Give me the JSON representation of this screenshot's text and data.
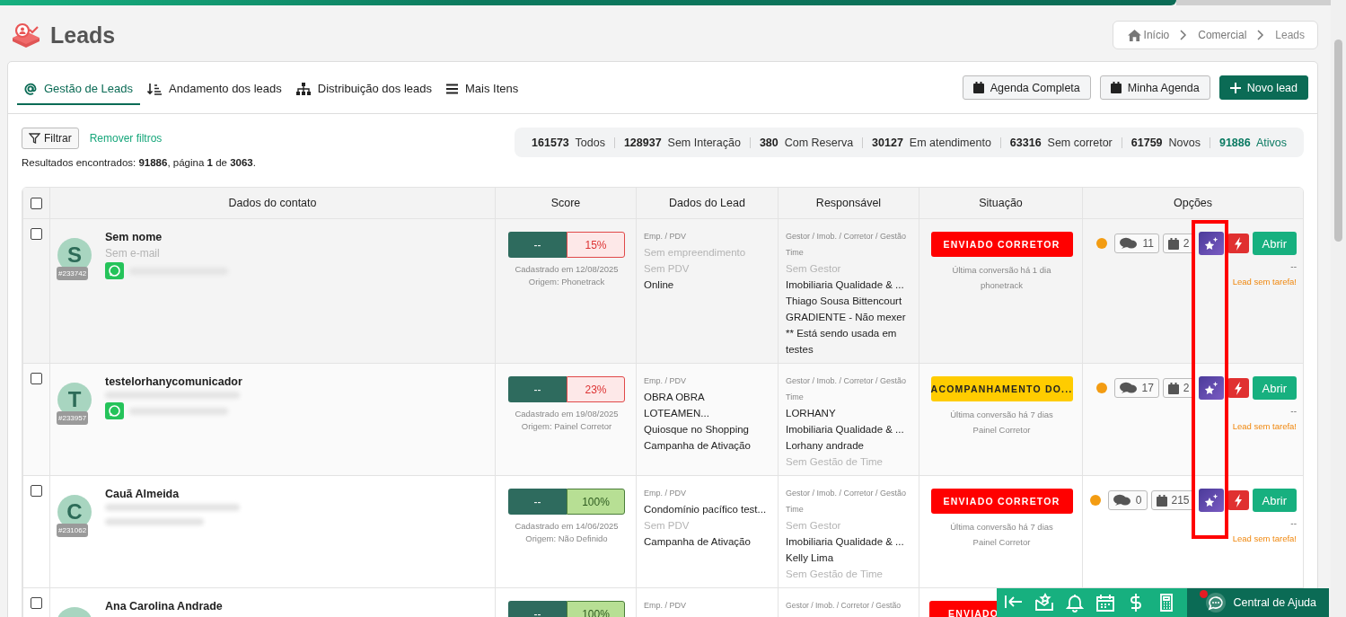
{
  "page": {
    "title": "Leads"
  },
  "breadcrumb": [
    {
      "label": "Início",
      "kind": "home"
    },
    {
      "label": "Comercial",
      "kind": "link"
    },
    {
      "label": "Leads",
      "kind": "current"
    }
  ],
  "tabs": [
    {
      "label": "Gestão de Leads",
      "selected": true
    },
    {
      "label": "Andamento dos leads",
      "selected": false
    },
    {
      "label": "Distribuição dos leads",
      "selected": false
    },
    {
      "label": "Mais Itens",
      "selected": false
    }
  ],
  "actions": [
    {
      "label": "Agenda Completa",
      "kind": "outline"
    },
    {
      "label": "Minha Agenda",
      "kind": "outline"
    },
    {
      "label": "Novo lead",
      "kind": "primary"
    }
  ],
  "filter": {
    "button": "Filtrar",
    "clear": "Remover filtros"
  },
  "results": "Resultados encontrados: **91886**, página **1** de **3063**.",
  "counters": [
    {
      "count": "161573",
      "label": "Todos",
      "selected": false
    },
    {
      "count": "128937",
      "label": "Sem Interação",
      "selected": false
    },
    {
      "count": "380",
      "label": "Com Reserva",
      "selected": false
    },
    {
      "count": "30127",
      "label": "Em atendimento",
      "selected": false
    },
    {
      "count": "63316",
      "label": "Sem corretor",
      "selected": false
    },
    {
      "count": "61759",
      "label": "Novos",
      "selected": false
    },
    {
      "count": "91886",
      "label": "Ativos",
      "selected": true
    }
  ],
  "table": {
    "all_checked": false,
    "columns": [
      "Dados do contato",
      "Score",
      "Dados do Lead",
      "Responsável",
      "Situação",
      "Opções"
    ],
    "rows": [
      {
        "checked": false,
        "initial": "S",
        "id": "#233742",
        "name": "Sem nome",
        "email": "Sem e-mail",
        "whatsapp": true,
        "score": "--",
        "percent": "15%",
        "high_score": false,
        "registered": "Cadastrado em 12/08/2025",
        "origin": "Origem: Phonetrack",
        "lead_label": "Emp. / PDV",
        "lead_lines": [
          {
            "text": "Sem empreendimento",
            "muted": true
          },
          {
            "text": "Sem PDV",
            "muted": true
          },
          {
            "text": "Online",
            "muted": false
          }
        ],
        "resp_label": "Gestor / Imob. / Corretor / Gestão Time",
        "resp_lines": [
          {
            "text": "Sem Gestor",
            "muted": true
          },
          {
            "text": "Imobiliaria Qualidade & ...",
            "muted": false
          },
          {
            "text": "Thiago Sousa Bittencourt GRADIENTE - Não mexer ** Está sendo usada em testes",
            "muted": false
          }
        ],
        "status": "ENVIADO CORRETOR",
        "color": "#ff0000",
        "last": "Última conversão há 1 dia",
        "source": "phonetrack",
        "messages": "11",
        "tasks": "2",
        "open": "Abrir",
        "extra": "--",
        "task_note": "Lead sem tarefa!"
      },
      {
        "checked": false,
        "initial": "T",
        "id": "#233957",
        "name": "testelorhanycomunicador",
        "whatsapp": true,
        "score": "--",
        "percent": "23%",
        "high_score": false,
        "registered": "Cadastrado em 19/08/2025",
        "origin": "Origem: Painel Corretor",
        "lead_label": "Emp. / PDV",
        "lead_lines": [
          {
            "text": "OBRA OBRA LOTEAMEN...",
            "muted": false
          },
          {
            "text": "Quiosque no Shopping",
            "muted": false
          },
          {
            "text": "Campanha de Ativação",
            "muted": false
          }
        ],
        "resp_label": "Gestor / Imob. / Corretor / Gestão Time",
        "resp_lines": [
          {
            "text": "LORHANY",
            "muted": false
          },
          {
            "text": "Imobiliaria Qualidade & ...",
            "muted": false
          },
          {
            "text": "Lorhany andrade",
            "muted": false
          },
          {
            "text": "Sem Gestão de Time",
            "muted": true
          }
        ],
        "status": "ACOMPANHAMENTO DO...",
        "color": "#ffcc00",
        "last": "Última conversão há 7 dias",
        "source": "Painel Corretor",
        "messages": "17",
        "tasks": "2",
        "open": "Abrir",
        "extra": "--",
        "task_note": "Lead sem tarefa!"
      },
      {
        "checked": false,
        "initial": "C",
        "id": "#231062",
        "name": "Cauã Almeida",
        "whatsapp": false,
        "score": "--",
        "percent": "100%",
        "high_score": true,
        "registered": "Cadastrado em 14/06/2025",
        "origin": "Origem: Não Definido",
        "lead_label": "Emp. / PDV",
        "lead_lines": [
          {
            "text": "Condomínio pacífico test...",
            "muted": false
          },
          {
            "text": "Sem PDV",
            "muted": true
          },
          {
            "text": "Campanha de Ativação",
            "muted": false
          }
        ],
        "resp_label": "Gestor / Imob. / Corretor / Gestão Time",
        "resp_lines": [
          {
            "text": "Sem Gestor",
            "muted": true
          },
          {
            "text": "Imobiliaria Qualidade & ...",
            "muted": false
          },
          {
            "text": "Kelly Lima",
            "muted": false
          },
          {
            "text": "Sem Gestão de Time",
            "muted": true
          }
        ],
        "status": "ENVIADO CORRETOR",
        "color": "#ff0000",
        "last": "Última conversão há 7 dias",
        "source": "Painel Corretor",
        "messages": "0",
        "tasks": "215",
        "open": "Abrir",
        "extra": "--",
        "task_note": "Lead sem tarefa!"
      },
      {
        "checked": false,
        "name": "Ana Carolina Andrade",
        "score": "--",
        "percent": "100%",
        "high_score": true,
        "lead_label": "Emp. / PDV",
        "resp_label": "Gestor / Imob. / Corretor / Gestão",
        "status": "ENVIADO",
        "color": "#ff0000"
      }
    ]
  },
  "help_bar": {
    "label": "Central de Ajuda",
    "notification": true
  }
}
